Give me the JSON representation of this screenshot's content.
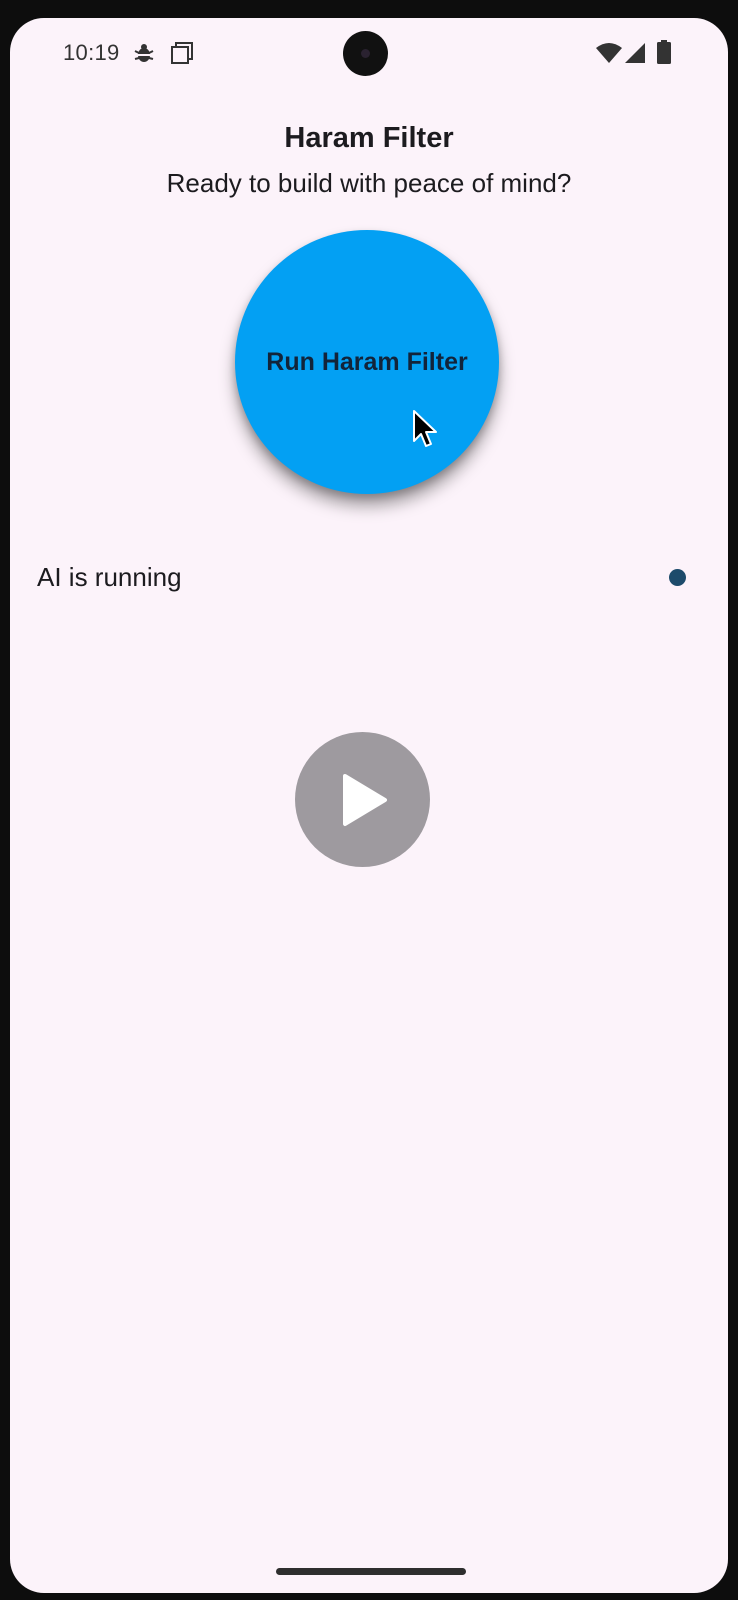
{
  "status_bar": {
    "time": "10:19",
    "icons": [
      "bug-icon",
      "screenshot-icon",
      "wifi-icon",
      "signal-icon",
      "battery-icon"
    ]
  },
  "header": {
    "title": "Haram Filter",
    "subtitle": "Ready to build with peace of mind?"
  },
  "main_button": {
    "label": "Run Haram Filter",
    "color": "#03a0f3"
  },
  "status_row": {
    "text": "AI is running",
    "indicator_color": "#1d4b6b"
  },
  "media": {
    "icon": "play-icon"
  },
  "colors": {
    "background": "#fcf3fa",
    "text": "#1c1b1f"
  }
}
